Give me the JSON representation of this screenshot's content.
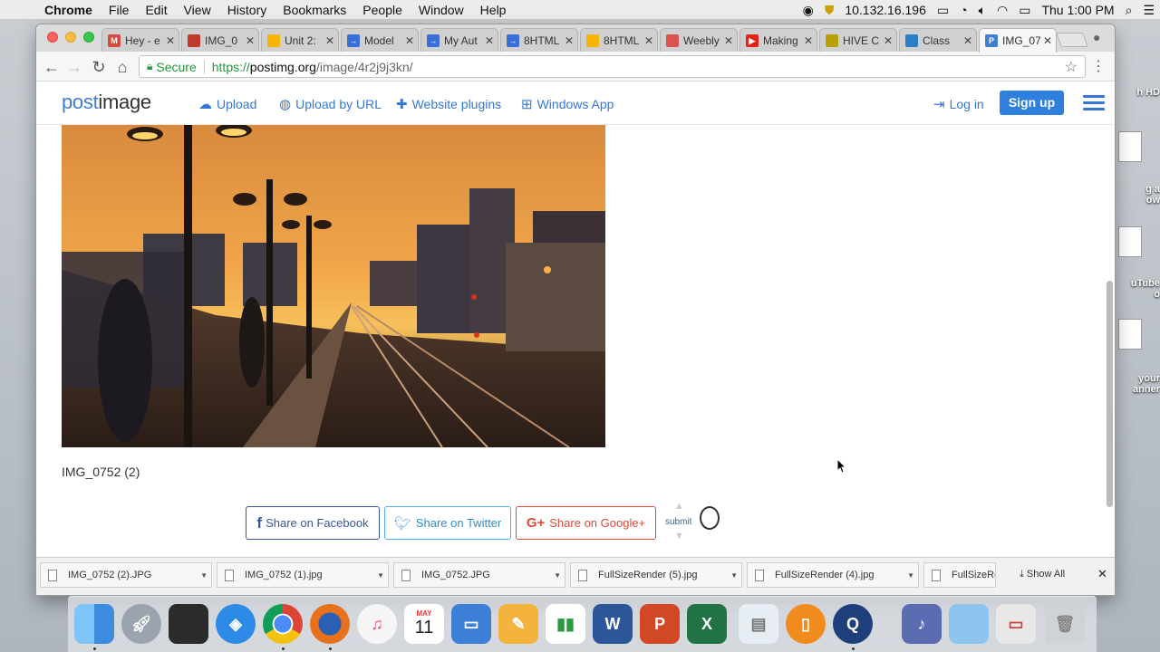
{
  "menubar": {
    "app": "Chrome",
    "items": [
      "File",
      "Edit",
      "View",
      "History",
      "Bookmarks",
      "People",
      "Window",
      "Help"
    ],
    "ip": "10.132.16.196",
    "clock": "Thu 1:00 PM"
  },
  "desktop_labels": [
    "h HD",
    "g a\now",
    "uTube\no",
    "your\nanner"
  ],
  "tabs": [
    {
      "title": "Hey - e",
      "icon": "gmail-icon",
      "color": "#d54b3d",
      "glyph": "M"
    },
    {
      "title": "IMG_0",
      "icon": "photo-icon",
      "color": "#c0392b",
      "glyph": ""
    },
    {
      "title": "Unit 2:",
      "icon": "google-drive-icon",
      "color": "#f4b400",
      "glyph": ""
    },
    {
      "title": "Model",
      "icon": "arrow-doc-icon",
      "color": "#3a6fd8",
      "glyph": "→"
    },
    {
      "title": "My Aut",
      "icon": "arrow-doc-icon",
      "color": "#3a6fd8",
      "glyph": "→"
    },
    {
      "title": "8HTML",
      "icon": "arrow-doc-icon",
      "color": "#3a6fd8",
      "glyph": "→"
    },
    {
      "title": "8HTML",
      "icon": "slides-icon",
      "color": "#f4b400",
      "glyph": ""
    },
    {
      "title": "Weebly",
      "icon": "weebly-icon",
      "color": "#d9534f",
      "glyph": ""
    },
    {
      "title": "Making",
      "icon": "youtube-icon",
      "color": "#e62117",
      "glyph": "▶"
    },
    {
      "title": "HIVE C",
      "icon": "hive-icon",
      "color": "#b8a000",
      "glyph": ""
    },
    {
      "title": "Class",
      "icon": "classdojo-icon",
      "color": "#2a7fc7",
      "glyph": ""
    },
    {
      "title": "IMG_07",
      "icon": "postimage-icon",
      "color": "#3f7ed1",
      "glyph": "P"
    }
  ],
  "address": {
    "secure_label": "Secure",
    "url_scheme": "https://",
    "url_host": "postimg.org",
    "url_path": "/image/4r2j9j3kn/"
  },
  "site": {
    "logo_a": "post",
    "logo_b": "image",
    "nav": [
      {
        "label": "Upload",
        "icon": "cloud-upload-icon"
      },
      {
        "label": "Upload by URL",
        "icon": "globe-icon"
      },
      {
        "label": "Website plugins",
        "icon": "puzzle-icon"
      },
      {
        "label": "Windows App",
        "icon": "windows-icon"
      }
    ],
    "login": "Log in",
    "signup": "Sign up"
  },
  "image_caption": "IMG_0752 (2)",
  "share": {
    "facebook": "Share on Facebook",
    "twitter": "Share on Twitter",
    "google": "Share on Google+",
    "reddit": "submit"
  },
  "downloads": {
    "items": [
      "IMG_0752 (2).JPG",
      "IMG_0752 (1).jpg",
      "IMG_0752.JPG",
      "FullSizeRender (5).jpg",
      "FullSizeRender (4).jpg",
      "FullSizeRende"
    ],
    "show_all": "Show All"
  },
  "dock": {
    "calendar_month": "MAY",
    "calendar_day": "11",
    "apps": [
      "finder",
      "launchpad",
      "photo-booth",
      "safari",
      "chrome",
      "firefox",
      "itunes",
      "calendar",
      "keynote",
      "pages",
      "numbers",
      "word",
      "powerpoint",
      "excel",
      "preview",
      "ibooks",
      "quicktime",
      "ilife",
      "folder",
      "screenshot",
      "trash"
    ]
  }
}
